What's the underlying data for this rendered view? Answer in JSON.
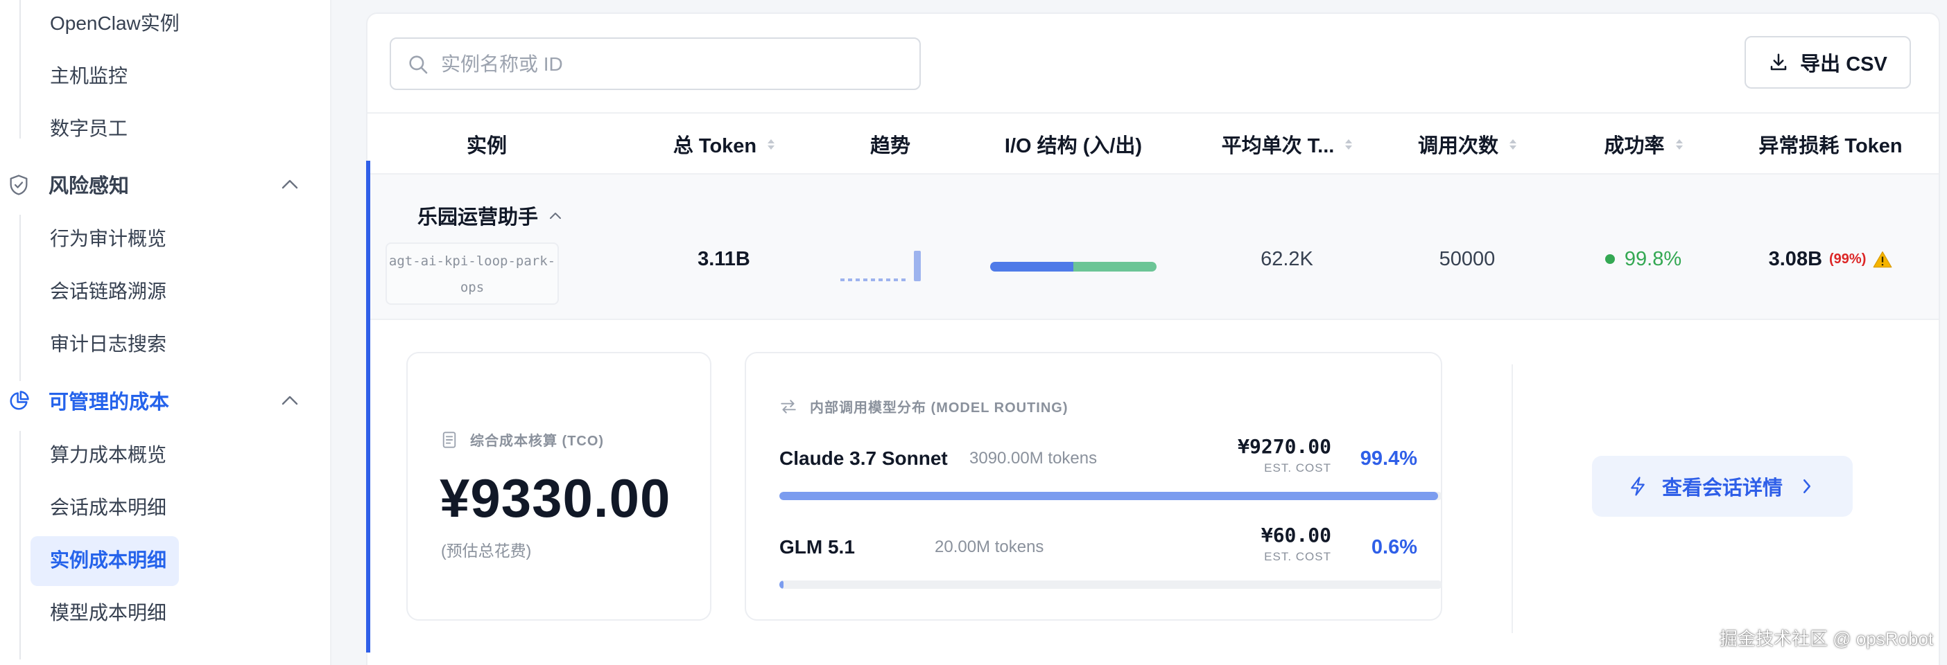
{
  "sidebar": {
    "items_top": [
      "OpenClaw实例",
      "主机监控",
      "数字员工"
    ],
    "groups": [
      {
        "label": "风险感知",
        "icon": "shield-check-icon",
        "children": [
          "行为审计概览",
          "会话链路溯源",
          "审计日志搜索"
        ]
      },
      {
        "label": "可管理的成本",
        "icon": "pie-chart-icon",
        "children": [
          "算力成本概览",
          "会话成本明细",
          "实例成本明细",
          "模型成本明细"
        ]
      }
    ],
    "active_item": "实例成本明细",
    "accent_color": "#2563eb"
  },
  "toolbar": {
    "search_placeholder": "实例名称或 ID",
    "export_label": "导出 CSV"
  },
  "table": {
    "columns": [
      "实例",
      "总 Token",
      "趋势",
      "I/O 结构 (入/出)",
      "平均单次 T...",
      "调用次数",
      "成功率",
      "异常损耗 Token"
    ],
    "row": {
      "instance_name": "乐园运营助手",
      "instance_id_line1": "agt-ai-kpi-loop-park-",
      "instance_id_line2": "ops",
      "total_token": "3.11B",
      "io_input_fraction": 0.5,
      "avg_token": "62.2K",
      "calls": "50000",
      "success_rate": "99.8%",
      "abnormal_token": "3.08B",
      "abnormal_pct": "(99%)"
    }
  },
  "detail": {
    "tco": {
      "label": "综合成本核算 (TCO)",
      "amount": "¥9330.00",
      "sub": "(预估总花费)"
    },
    "routing": {
      "title": "内部调用模型分布 (MODEL ROUTING)",
      "models": [
        {
          "name": "Claude 3.7 Sonnet",
          "tokens": "3090.00M tokens",
          "cost": "¥9270.00",
          "est": "EST. COST",
          "pct": "99.4%",
          "fraction": 0.994
        },
        {
          "name": "GLM 5.1",
          "tokens": "20.00M tokens",
          "cost": "¥60.00",
          "est": "EST. COST",
          "pct": "0.6%",
          "fraction": 0.006
        }
      ]
    },
    "view_button": "查看会话详情"
  },
  "watermark": "掘金技术社区 @ opsRobot",
  "colors": {
    "io_input": "#4f7be8",
    "io_output": "#6cc596",
    "success": "#34a853",
    "danger": "#dc2626",
    "primary": "#2f5fe8"
  }
}
